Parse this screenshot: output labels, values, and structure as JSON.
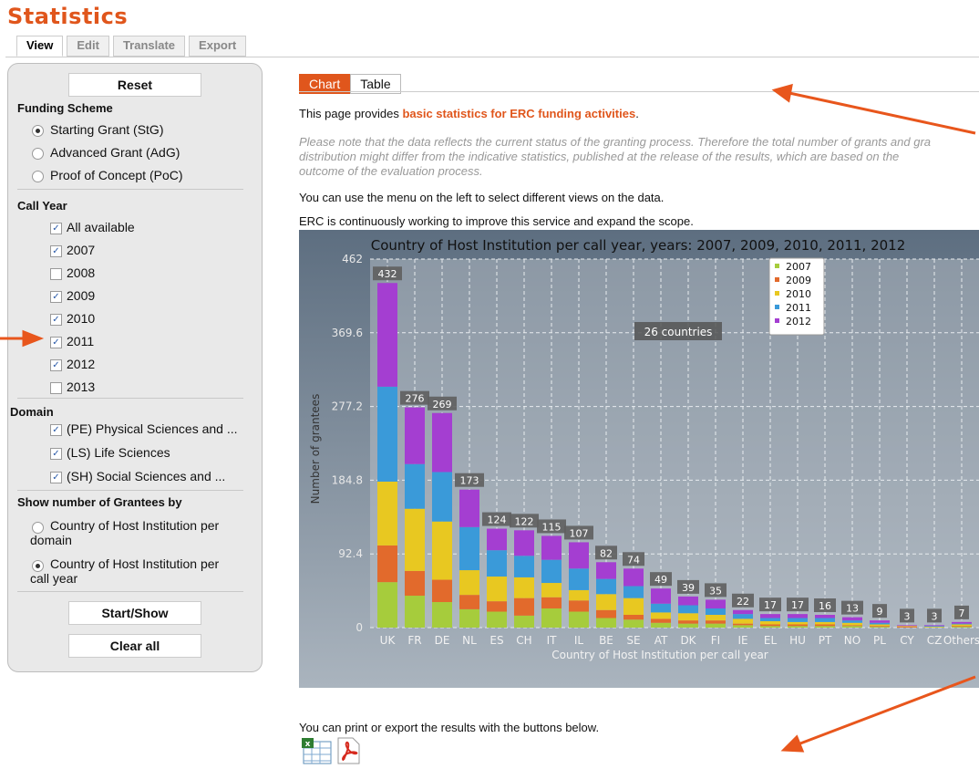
{
  "page": {
    "title": "Statistics"
  },
  "top_tabs": [
    "View",
    "Edit",
    "Translate",
    "Export"
  ],
  "sidebar": {
    "reset": "Reset",
    "funding_scheme": {
      "heading": "Funding Scheme",
      "options": [
        "Starting Grant (StG)",
        "Advanced Grant (AdG)",
        "Proof of Concept (PoC)"
      ],
      "selected": 0
    },
    "call_year": {
      "heading": "Call Year",
      "options": [
        {
          "label": "All available",
          "checked": true
        },
        {
          "label": "2007",
          "checked": true
        },
        {
          "label": "2008",
          "checked": false
        },
        {
          "label": "2009",
          "checked": true
        },
        {
          "label": "2010",
          "checked": true
        },
        {
          "label": "2011",
          "checked": true
        },
        {
          "label": "2012",
          "checked": true
        },
        {
          "label": "2013",
          "checked": false
        }
      ]
    },
    "domain": {
      "heading": "Domain",
      "options": [
        {
          "label": "(PE) Physical Sciences and ...",
          "checked": true
        },
        {
          "label": "(LS) Life Sciences",
          "checked": true
        },
        {
          "label": "(SH) Social Sciences and ...",
          "checked": true
        }
      ]
    },
    "show_by": {
      "heading": "Show number of Grantees by",
      "options": [
        {
          "line1": "Country of Host Institution per",
          "line2": "domain"
        },
        {
          "line1": "Country of Host Institution per",
          "line2": "call year"
        }
      ],
      "selected": 1
    },
    "start": "Start/Show",
    "clear": "Clear all"
  },
  "content": {
    "tabs": [
      "Chart",
      "Table"
    ],
    "intro_prefix": "This page provides ",
    "intro_link": "basic statistics for ERC funding activities",
    "intro_suffix": ".",
    "note_line1": "Please note that the data reflects the current status of the granting process. Therefore the total number of grants and gra",
    "note_line2": "distribution might differ from the indicative statistics, published at the release of the results, which are based on the",
    "note_line3": "outcome of the evaluation process.",
    "menu_text": "You can use the menu on the left to select different views on the data.",
    "improve_text": "ERC is continuously working to improve this service and expand the scope.",
    "export_text": "You can print or export the results with the buttons below."
  },
  "icons": [
    "excel-icon",
    "pdf-icon"
  ],
  "annotation_color": "#e8561c",
  "chart_data": {
    "type": "bar",
    "stacked": true,
    "title": "Country of Host Institution per call year, years: 2007, 2009, 2010, 2011, 2012",
    "xlabel": "Country of Host Institution per call year",
    "ylabel": "Number of grantees",
    "ylim": [
      0,
      462
    ],
    "yticks": [
      "0",
      "92.4",
      "184.8",
      "277.2",
      "369.6",
      "462"
    ],
    "badge": "26 countries",
    "legend_position": "top-right",
    "categories": [
      "UK",
      "FR",
      "DE",
      "NL",
      "ES",
      "CH",
      "IT",
      "IL",
      "BE",
      "SE",
      "AT",
      "DK",
      "FI",
      "IE",
      "EL",
      "HU",
      "PT",
      "NO",
      "PL",
      "CY",
      "CZ",
      "Others"
    ],
    "totals": [
      432,
      276,
      269,
      173,
      124,
      122,
      115,
      107,
      82,
      74,
      49,
      39,
      35,
      22,
      17,
      17,
      16,
      13,
      9,
      3,
      3,
      7
    ],
    "series": [
      {
        "name": "2007",
        "color": "#a6cc3c",
        "values": [
          57,
          40,
          32,
          23,
          20,
          15,
          24,
          20,
          12,
          10,
          6,
          5,
          5,
          3,
          2,
          2,
          2,
          2,
          1,
          0,
          0,
          1
        ]
      },
      {
        "name": "2009",
        "color": "#e26a2c",
        "values": [
          46,
          31,
          28,
          18,
          13,
          22,
          14,
          14,
          10,
          6,
          5,
          4,
          4,
          2,
          2,
          2,
          2,
          1,
          1,
          1,
          0,
          1
        ]
      },
      {
        "name": "2010",
        "color": "#e8c821",
        "values": [
          80,
          78,
          73,
          31,
          31,
          26,
          18,
          13,
          20,
          21,
          8,
          9,
          7,
          6,
          4,
          3,
          3,
          3,
          2,
          1,
          1,
          2
        ]
      },
      {
        "name": "2011",
        "color": "#3a9ad9",
        "values": [
          119,
          56,
          62,
          54,
          33,
          27,
          29,
          27,
          19,
          15,
          11,
          10,
          8,
          6,
          4,
          5,
          5,
          3,
          2,
          0,
          1,
          1
        ]
      },
      {
        "name": "2012",
        "color": "#a43ed1",
        "values": [
          130,
          71,
          74,
          47,
          27,
          32,
          30,
          33,
          21,
          22,
          19,
          11,
          11,
          5,
          5,
          5,
          4,
          4,
          3,
          1,
          1,
          2
        ]
      }
    ]
  }
}
